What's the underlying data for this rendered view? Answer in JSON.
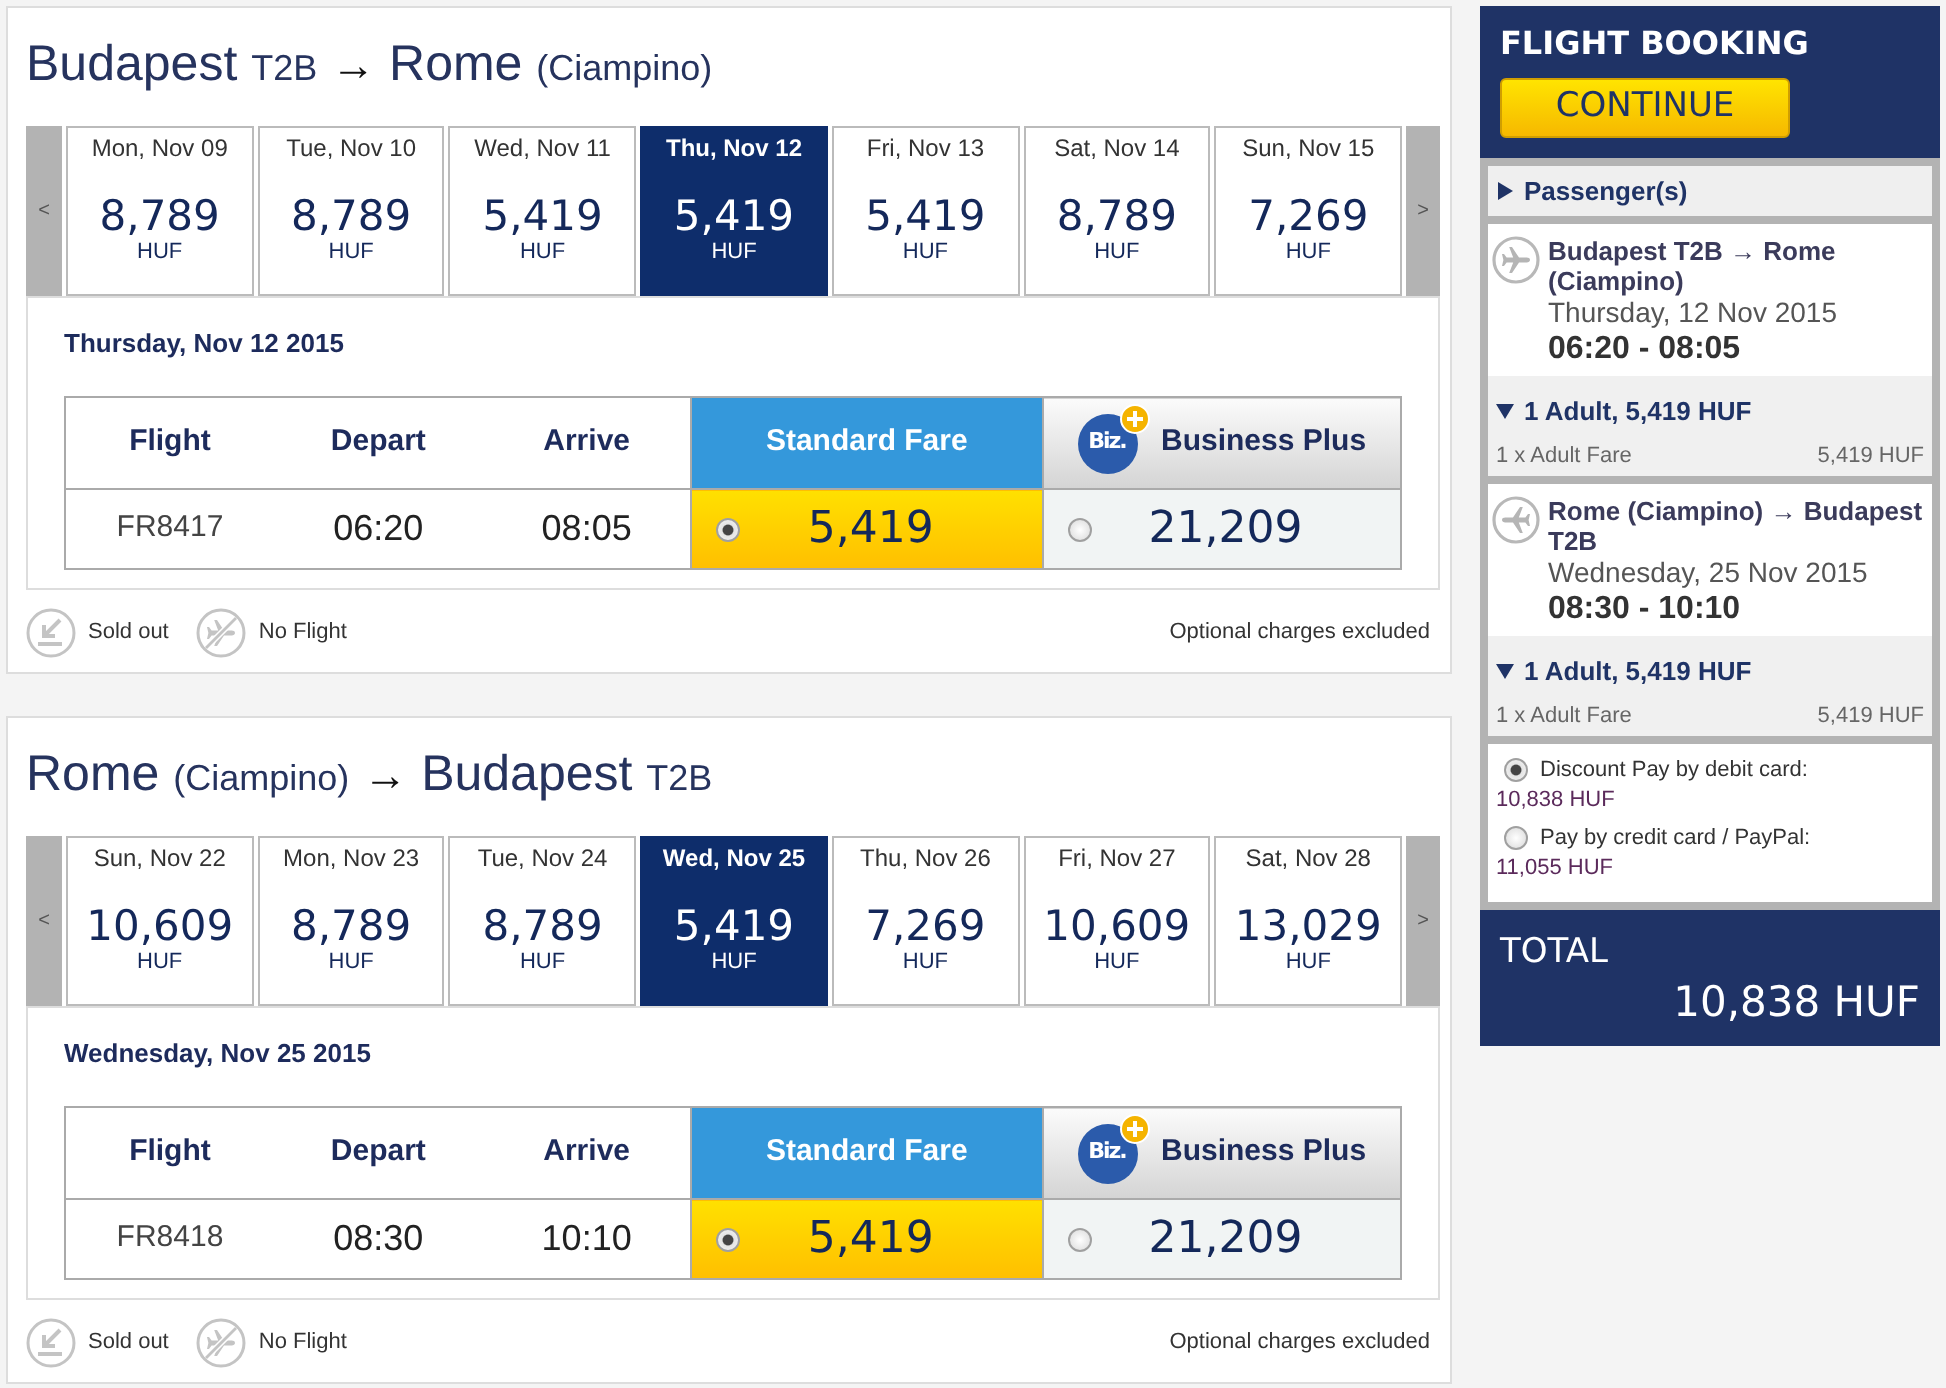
{
  "journeys": [
    {
      "title_parts": [
        {
          "text": "Budapest",
          "kind": "place"
        },
        {
          "text": "T2B",
          "kind": "detail"
        },
        {
          "text": "→",
          "kind": "arrow"
        },
        {
          "text": "Rome",
          "kind": "place"
        },
        {
          "text": "(Ciampino)",
          "kind": "detail"
        }
      ],
      "prev_label": "<",
      "next_label": ">",
      "days": [
        {
          "day": "Mon, Nov 09",
          "price": "8,789",
          "currency": "HUF",
          "selected": false
        },
        {
          "day": "Tue, Nov 10",
          "price": "8,789",
          "currency": "HUF",
          "selected": false
        },
        {
          "day": "Wed, Nov 11",
          "price": "5,419",
          "currency": "HUF",
          "selected": false
        },
        {
          "day": "Thu, Nov 12",
          "price": "5,419",
          "currency": "HUF",
          "selected": true
        },
        {
          "day": "Fri, Nov 13",
          "price": "5,419",
          "currency": "HUF",
          "selected": false
        },
        {
          "day": "Sat, Nov 14",
          "price": "8,789",
          "currency": "HUF",
          "selected": false
        },
        {
          "day": "Sun, Nov 15",
          "price": "7,269",
          "currency": "HUF",
          "selected": false
        }
      ],
      "date_heading": "Thursday, Nov 12 2015",
      "columns": [
        {
          "label": "Flight",
          "kind": "plain"
        },
        {
          "label": "Depart",
          "kind": "plain"
        },
        {
          "label": "Arrive",
          "kind": "plain"
        },
        {
          "label": "Standard Fare",
          "kind": "standard"
        },
        {
          "label": "Business Plus",
          "kind": "business",
          "logo": "Biz."
        }
      ],
      "flights": [
        {
          "number": "FR8417",
          "depart": "06:20",
          "arrive": "08:05",
          "fares": [
            {
              "price": "5,419",
              "selected": true
            },
            {
              "price": "21,209",
              "selected": false
            }
          ]
        }
      ],
      "legend": [
        {
          "label": "Sold out",
          "kind": "sold_out"
        },
        {
          "label": "No Flight",
          "kind": "no_flight"
        }
      ],
      "note": "Optional charges excluded"
    },
    {
      "title_parts": [
        {
          "text": "Rome",
          "kind": "place"
        },
        {
          "text": "(Ciampino)",
          "kind": "detail"
        },
        {
          "text": "→",
          "kind": "arrow"
        },
        {
          "text": "Budapest",
          "kind": "place"
        },
        {
          "text": "T2B",
          "kind": "detail"
        }
      ],
      "prev_label": "<",
      "next_label": ">",
      "days": [
        {
          "day": "Sun, Nov 22",
          "price": "10,609",
          "currency": "HUF",
          "selected": false
        },
        {
          "day": "Mon, Nov 23",
          "price": "8,789",
          "currency": "HUF",
          "selected": false
        },
        {
          "day": "Tue, Nov 24",
          "price": "8,789",
          "currency": "HUF",
          "selected": false
        },
        {
          "day": "Wed, Nov 25",
          "price": "5,419",
          "currency": "HUF",
          "selected": true
        },
        {
          "day": "Thu, Nov 26",
          "price": "7,269",
          "currency": "HUF",
          "selected": false
        },
        {
          "day": "Fri, Nov 27",
          "price": "10,609",
          "currency": "HUF",
          "selected": false
        },
        {
          "day": "Sat, Nov 28",
          "price": "13,029",
          "currency": "HUF",
          "selected": false
        }
      ],
      "date_heading": "Wednesday, Nov 25 2015",
      "columns": [
        {
          "label": "Flight",
          "kind": "plain"
        },
        {
          "label": "Depart",
          "kind": "plain"
        },
        {
          "label": "Arrive",
          "kind": "plain"
        },
        {
          "label": "Standard Fare",
          "kind": "standard"
        },
        {
          "label": "Business Plus",
          "kind": "business",
          "logo": "Biz."
        }
      ],
      "flights": [
        {
          "number": "FR8418",
          "depart": "08:30",
          "arrive": "10:10",
          "fares": [
            {
              "price": "5,419",
              "selected": true
            },
            {
              "price": "21,209",
              "selected": false
            }
          ]
        }
      ],
      "legend": [
        {
          "label": "Sold out",
          "kind": "sold_out"
        },
        {
          "label": "No Flight",
          "kind": "no_flight"
        }
      ],
      "note": "Optional charges excluded"
    }
  ],
  "sidebar": {
    "title": "FLIGHT BOOKING",
    "continue_label": "CONTINUE",
    "passengers": {
      "label": "Passenger(s)",
      "expanded": false
    },
    "legs": [
      {
        "kind": "outbound",
        "route": "Budapest T2B → Rome (Ciampino)",
        "date": "Thursday, 12 Nov 2015",
        "times": "06:20 - 08:05",
        "fare_group": {
          "label": "1 Adult, 5,419 HUF",
          "expanded": true,
          "lines": [
            {
              "label": "1 x Adult Fare",
              "amount": "5,419 HUF"
            }
          ]
        }
      },
      {
        "kind": "return",
        "route": "Rome (Ciampino) → Budapest T2B",
        "date": "Wednesday, 25 Nov 2015",
        "times": "08:30 - 10:10",
        "fare_group": {
          "label": "1 Adult, 5,419 HUF",
          "expanded": true,
          "lines": [
            {
              "label": "1 x Adult Fare",
              "amount": "5,419 HUF"
            }
          ]
        }
      }
    ],
    "payment_options": [
      {
        "label": "Discount Pay by debit card:",
        "amount": "10,838 HUF",
        "selected": true
      },
      {
        "label": "Pay by credit card / PayPal:",
        "amount": "11,055 HUF",
        "selected": false
      }
    ],
    "total": {
      "label": "TOTAL",
      "amount": "10,838 HUF"
    }
  }
}
